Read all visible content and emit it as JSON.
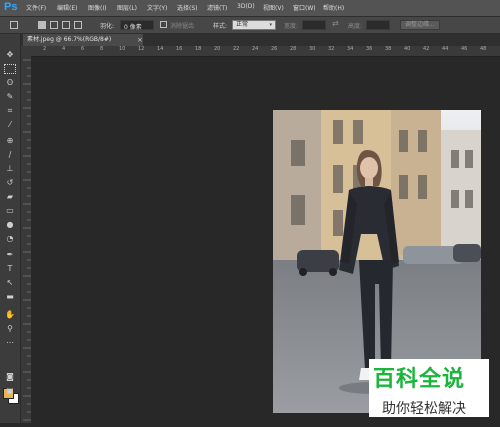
{
  "menubar": {
    "logo": "Ps",
    "items": [
      "文件(F)",
      "编辑(E)",
      "图像(I)",
      "图层(L)",
      "文字(Y)",
      "选择(S)",
      "滤镜(T)",
      "3D(D)",
      "视图(V)",
      "窗口(W)",
      "帮助(H)"
    ]
  },
  "options": {
    "feather_label": "羽化:",
    "feather_value": "0 像素",
    "antialias_label": "消除锯齿",
    "style_label": "样式:",
    "style_value": "正常",
    "width_label": "宽度:",
    "height_label": "高度:",
    "refine_edge": "调整边缘..."
  },
  "document": {
    "tab_title": "素材.jpeg @ 66.7%(RGB/8#)",
    "close_glyph": "×"
  },
  "ruler": {
    "top_ticks": [
      "2",
      "4",
      "6",
      "8",
      "10",
      "12",
      "14",
      "16",
      "18",
      "20",
      "22",
      "24",
      "26",
      "28",
      "30",
      "32",
      "34",
      "36",
      "38",
      "40",
      "42",
      "44",
      "46",
      "48"
    ]
  },
  "watermark": {
    "main": "百科全说",
    "sub": "助你轻松解决"
  },
  "colors": {
    "foreground": "#e3b45a",
    "background": "#ffffff",
    "watermark_green": "#1ab53a"
  }
}
